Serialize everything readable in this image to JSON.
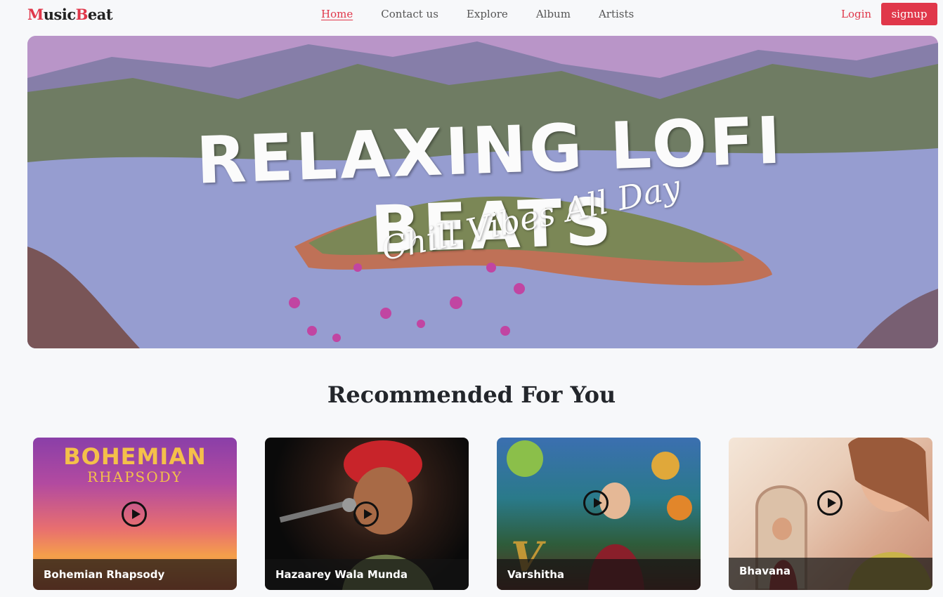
{
  "brand": {
    "first": "M",
    "second": "usic",
    "third": "B",
    "fourth": "eat"
  },
  "nav": {
    "links": [
      "Home",
      "Contact us",
      "Explore",
      "Album",
      "Artists"
    ],
    "login": "Login",
    "signup": "signup"
  },
  "hero": {
    "title": "RELAXING LOFI BEATS",
    "subtitle": "Chill Vibes All Day"
  },
  "section": {
    "title": "Recommended For You"
  },
  "cards": [
    {
      "title": "Bohemian Rhapsody",
      "cover_line1": "BOHEMIAN",
      "cover_line2": "RHAPSODY"
    },
    {
      "title": "Hazaarey Wala Munda"
    },
    {
      "title": "Varshitha"
    },
    {
      "title": "Bhavana"
    }
  ],
  "colors": {
    "accent": "#e0374a",
    "background": "#f7f8fa",
    "heading": "#23262b"
  }
}
